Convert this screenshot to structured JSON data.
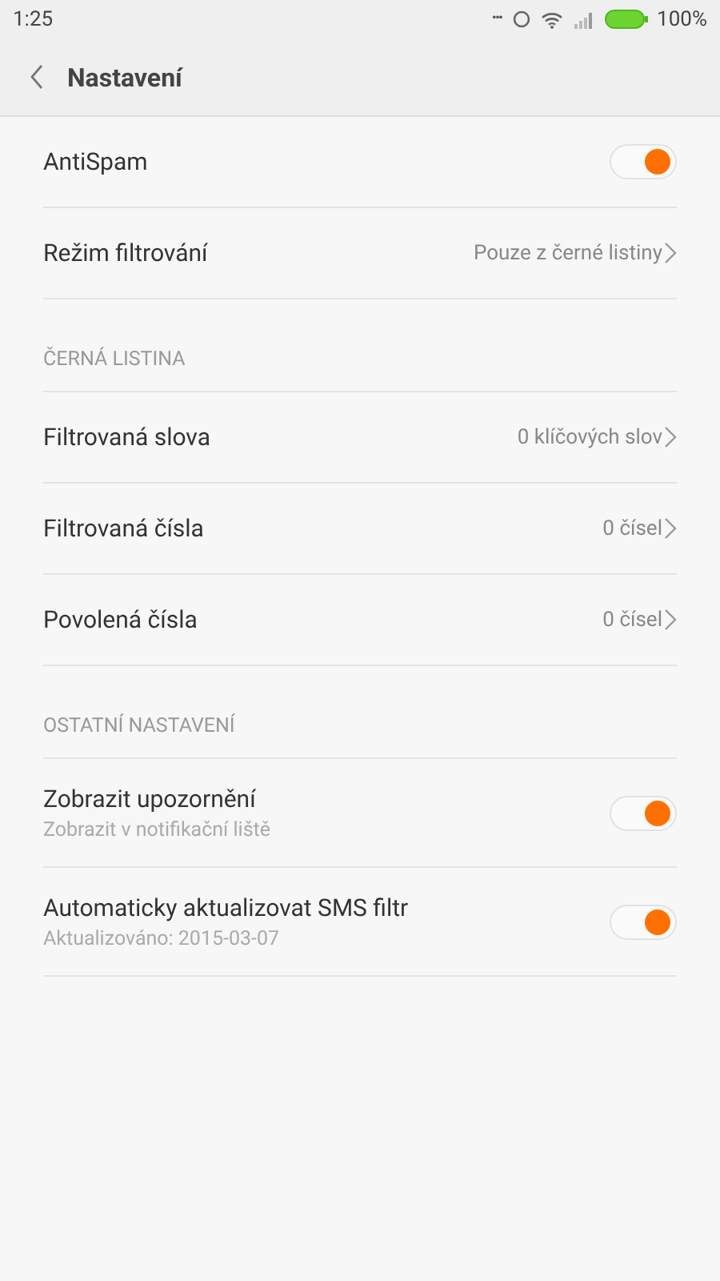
{
  "status_bar": {
    "time": "1:25",
    "dots": "•••",
    "battery_text": "100%"
  },
  "header": {
    "title": "Nastavení"
  },
  "sections": [
    {
      "items": [
        {
          "kind": "toggle",
          "title": "AntiSpam",
          "on": true
        },
        {
          "kind": "link",
          "title": "Režim filtrování",
          "value": "Pouze z černé listiny"
        }
      ]
    },
    {
      "header": "ČERNÁ LISTINA",
      "items": [
        {
          "kind": "link",
          "title": "Filtrovaná slova",
          "value": "0 klíčových slov"
        },
        {
          "kind": "link",
          "title": "Filtrovaná čísla",
          "value": "0 čísel"
        },
        {
          "kind": "link",
          "title": "Povolená čísla",
          "value": "0 čísel"
        }
      ]
    },
    {
      "header": "OSTATNÍ NASTAVENÍ",
      "items": [
        {
          "kind": "toggle",
          "title": "Zobrazit upozornění",
          "subtitle": "Zobrazit v notifikační liště",
          "on": true
        },
        {
          "kind": "toggle",
          "title": "Automaticky aktualizovat SMS filtr",
          "subtitle": "Aktualizováno: 2015-03-07",
          "on": true
        }
      ]
    }
  ]
}
